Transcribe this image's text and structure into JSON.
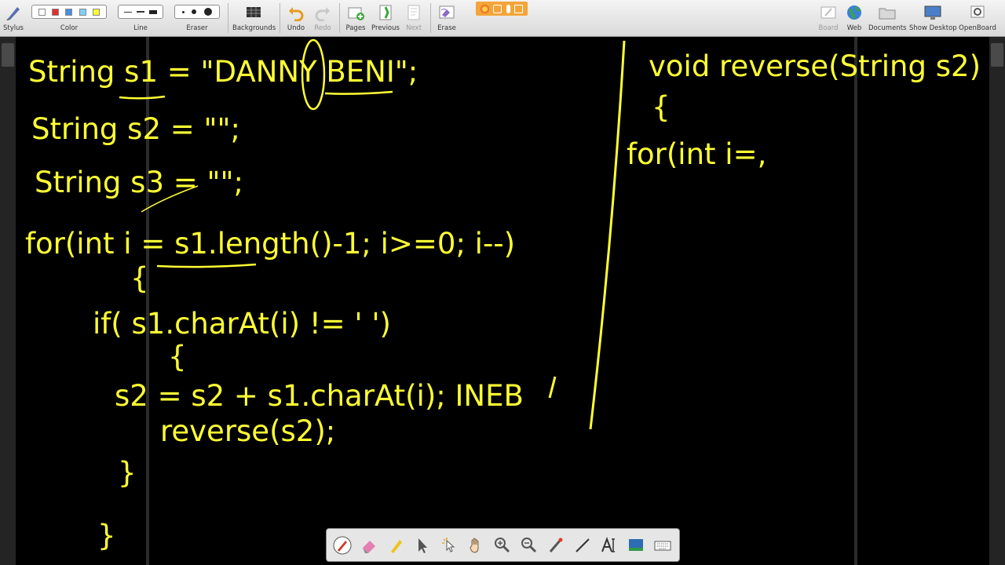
{
  "toolbar": {
    "stylus_label": "Stylus",
    "color_label": "Color",
    "line_label": "Line",
    "eraser_label": "Eraser",
    "backgrounds_label": "Backgrounds",
    "undo_label": "Undo",
    "redo_label": "Redo",
    "pages_label": "Pages",
    "previous_label": "Previous",
    "next_label": "Next",
    "erase_label": "Erase",
    "board_label": "Board",
    "web_label": "Web",
    "documents_label": "Documents",
    "show_desktop_label": "Show Desktop",
    "openboard_label": "OpenBoard",
    "colors": [
      "#ffffff",
      "#e03030",
      "#4a90e2",
      "#7fd0ff",
      "#ffff33"
    ]
  },
  "board": {
    "ink_color": "#ffff33",
    "left_lines": [
      "String s1 = \"DANNY BENI\";",
      "String s2 = \"\";",
      "String s3 = \"\";",
      "for(int i = s1.length()-1; i>=0; i--)",
      "{",
      "if( s1.charAt(i) != ' ')",
      "{",
      "s2 = s2 + s1.charAt(i); INEB",
      "reverse(s2);",
      "}",
      "}"
    ],
    "right_lines": [
      "void reverse(String s2)",
      "{",
      "for(int i=,"
    ]
  },
  "bottom_tools": [
    "pen-tool",
    "eraser-tool",
    "marker-tool",
    "selector-tool",
    "interact-tool",
    "hand-tool",
    "zoom-in-tool",
    "zoom-out-tool",
    "laser-pointer-tool",
    "line-tool",
    "text-tool",
    "capture-tool",
    "virtual-keyboard-tool"
  ]
}
